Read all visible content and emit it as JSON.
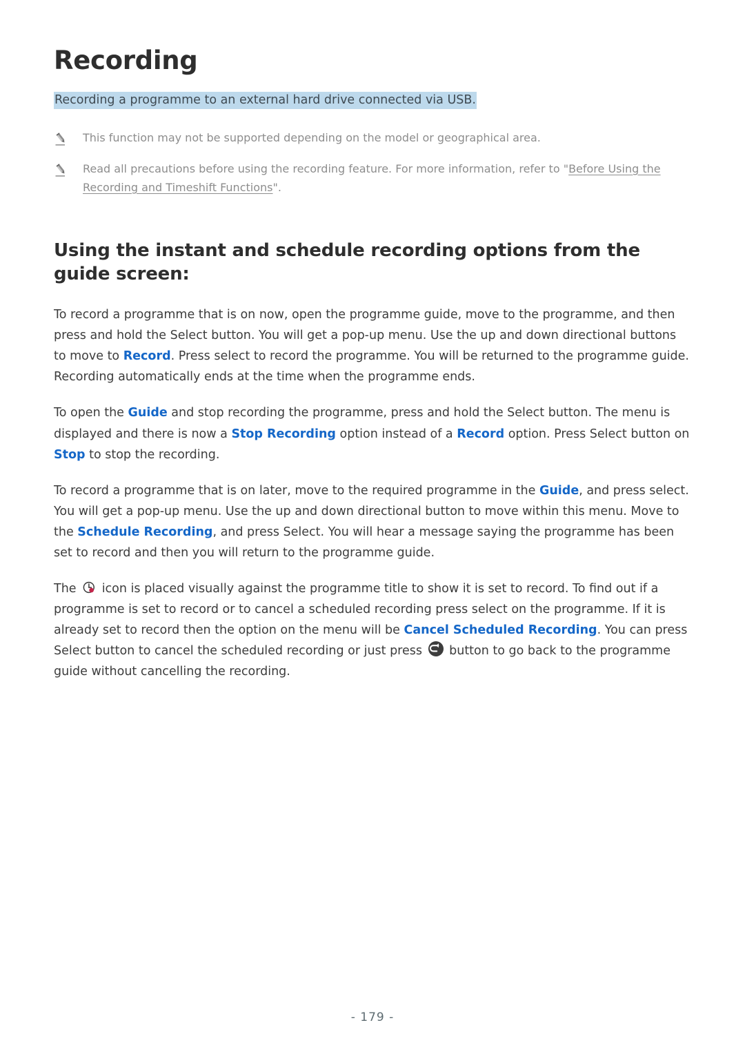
{
  "document": {
    "title": "Recording",
    "subtitle": "Recording a programme to an external hard drive connected via USB.",
    "page_number": "- 179 -"
  },
  "colors": {
    "title": "#2e2e2e",
    "highlight_background": "#bdd9ec",
    "term_blue": "#1567c8",
    "note_gray": "#8d8d8d",
    "body_text": "#3c3c3c",
    "page_number": "#5d6b70",
    "record_dot_red": "#c4254b",
    "return_button_fill": "#3d3d3d"
  },
  "notes": [
    {
      "icon": "pencil-icon",
      "text": "This function may not be supported depending on the model or geographical area."
    },
    {
      "icon": "pencil-icon",
      "text_before": "Read all precautions before using the recording feature. For more information, refer to \"",
      "link_text": "Before Using the Recording and Timeshift Functions",
      "text_after": "\"."
    }
  ],
  "section": {
    "heading": "Using the instant and schedule recording options from the guide screen:"
  },
  "paragraphs": [
    {
      "id": "record-now",
      "parts": [
        {
          "type": "text",
          "value": "To record a programme that is on now, open the programme guide, move to the programme, and then press and hold the Select button. You will get a pop-up menu. Use the up and down directional buttons to move to "
        },
        {
          "type": "term",
          "value": "Record"
        },
        {
          "type": "text",
          "value": ". Press select to record the programme. You will be returned to the programme guide. Recording automatically ends at the time when the programme ends."
        }
      ]
    },
    {
      "id": "stop-recording",
      "parts": [
        {
          "type": "text",
          "value": "To open the "
        },
        {
          "type": "term",
          "value": "Guide"
        },
        {
          "type": "text",
          "value": " and stop recording the programme, press and hold the Select button. The menu is displayed and there is now a "
        },
        {
          "type": "term",
          "value": "Stop Recording"
        },
        {
          "type": "text",
          "value": " option instead of a "
        },
        {
          "type": "term",
          "value": "Record"
        },
        {
          "type": "text",
          "value": " option. Press Select button on "
        },
        {
          "type": "term",
          "value": "Stop"
        },
        {
          "type": "text",
          "value": " to stop the recording."
        }
      ]
    },
    {
      "id": "schedule-recording",
      "parts": [
        {
          "type": "text",
          "value": "To record a programme that is on later, move to the required programme in the "
        },
        {
          "type": "term",
          "value": "Guide"
        },
        {
          "type": "text",
          "value": ", and press select. You will get a pop-up menu. Use the up and down directional button to move within this menu. Move to the "
        },
        {
          "type": "term",
          "value": "Schedule Recording"
        },
        {
          "type": "text",
          "value": ", and press Select. You will hear a message saying the programme has been set to record and then you will return to the programme guide."
        }
      ]
    },
    {
      "id": "cancel-scheduled-recording",
      "parts": [
        {
          "type": "text",
          "value": "The "
        },
        {
          "type": "icon",
          "value": "schedule-record-clock-icon"
        },
        {
          "type": "text",
          "value": " icon is placed visually against the programme title to show it is set to record. To find out if a programme is set to record or to cancel a scheduled recording press select on the programme. If it is already set to record then the option on the menu will be "
        },
        {
          "type": "term",
          "value": "Cancel Scheduled Recording"
        },
        {
          "type": "text",
          "value": ". You can press Select button to cancel the scheduled recording or just press "
        },
        {
          "type": "icon",
          "value": "return-button-icon"
        },
        {
          "type": "text",
          "value": " button to go back to the programme guide without cancelling the recording."
        }
      ]
    }
  ]
}
